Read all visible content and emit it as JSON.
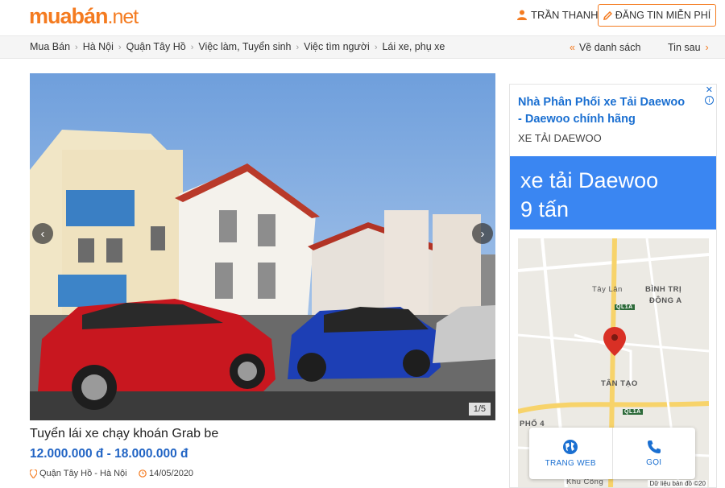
{
  "header": {
    "logo_main": "muabán",
    "logo_suffix": ".net",
    "user_name": "TRẦN THANH",
    "post_button": "ĐĂNG TIN MIỄN PHÍ",
    "brand_color": "#f47b20"
  },
  "breadcrumb": {
    "items": [
      "Mua Bán",
      "Hà Nội",
      "Quận Tây Hồ",
      "Việc làm, Tuyển sinh",
      "Việc tìm người",
      "Lái xe, phụ xe"
    ],
    "back_label": "Về danh sách",
    "next_label": "Tin sau"
  },
  "listing": {
    "photo_counter": "1/5",
    "title": "Tuyển lái xe chạy khoán Grab be",
    "price": "12.000.000 đ - 18.000.000 đ",
    "location": "Quận Tây Hồ - Hà Nội",
    "date": "14/05/2020",
    "price_color": "#2164c4"
  },
  "ad": {
    "headline": "Nhà Phân Phối xe Tải Daewoo - Daewoo chính hãng",
    "subtitle": "XE TẢI DAEWOO",
    "banner_line1": "xe tải Daewoo",
    "banner_line2": "9 tấn",
    "info_mark": "i",
    "close_mark": "✕",
    "map_labels": {
      "tay_lan": "Tây Lân",
      "binh_tri": "BÌNH TRỊ",
      "dong_a": "ĐÔNG A",
      "tan_tao": "TÂN TẠO",
      "ql1a_1": "QL1A",
      "ql1a_2": "QL1A",
      "phuong": "PHỐ 4",
      "khu_cong": "Khu Công"
    },
    "web_button": "TRANG WEB",
    "call_button": "GỌI",
    "map_credit": "Dữ liệu bản đồ ©20",
    "accent_color": "#3a86f2"
  }
}
